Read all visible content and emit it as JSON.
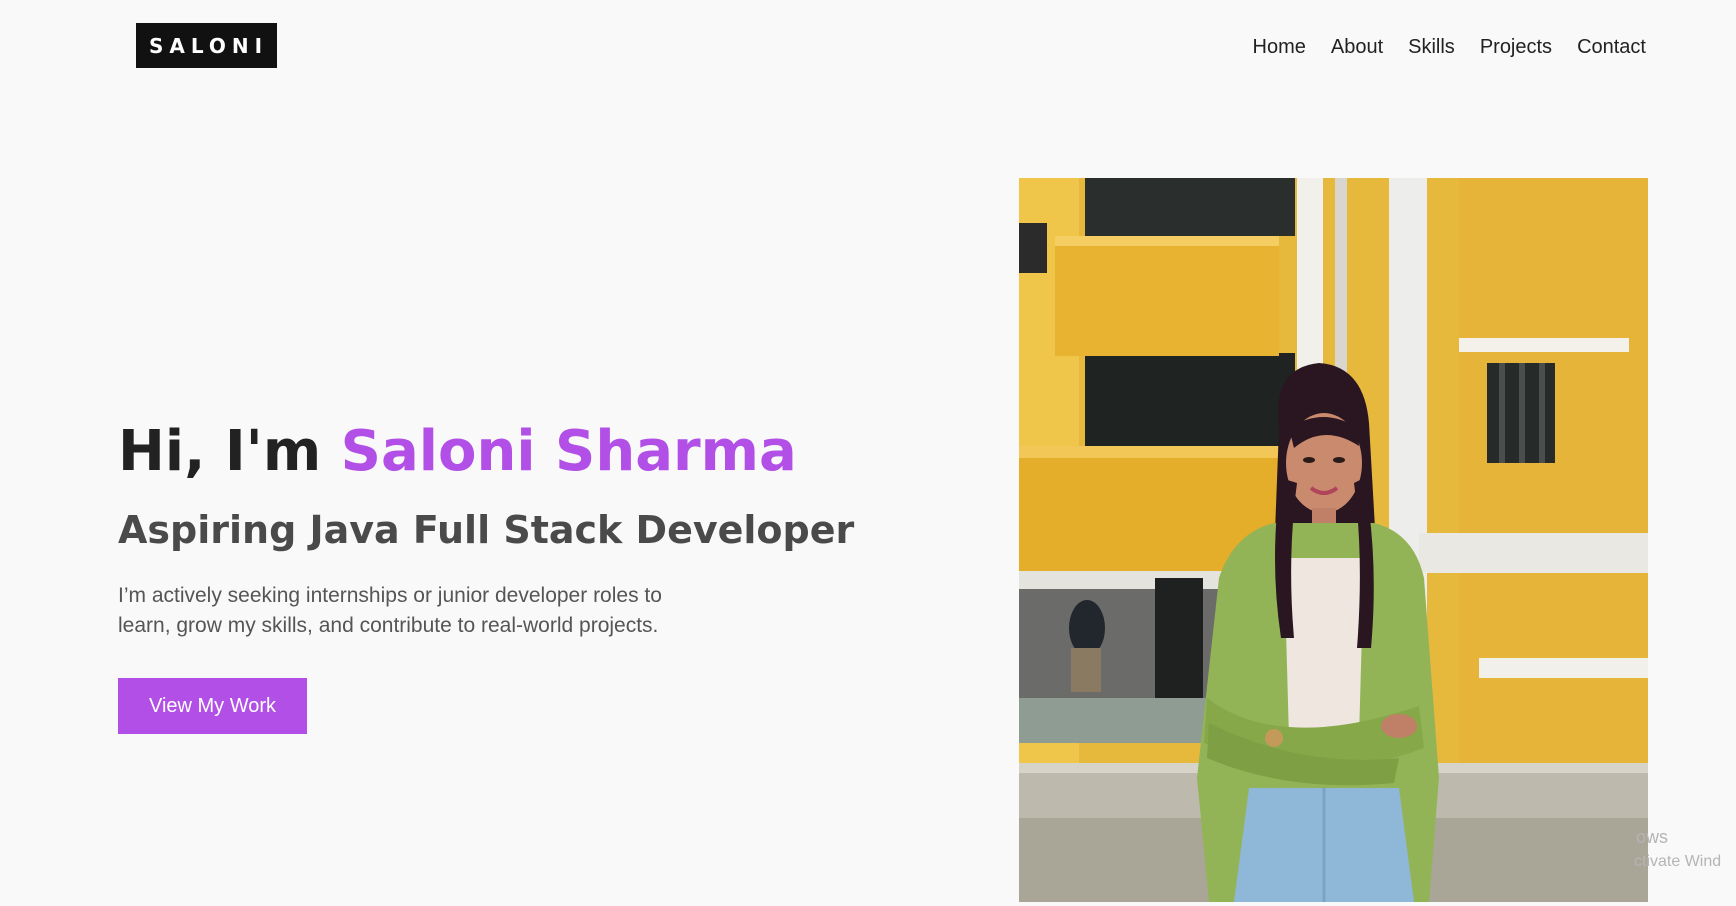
{
  "header": {
    "logo": "SALONI",
    "nav": [
      "Home",
      "About",
      "Skills",
      "Projects",
      "Contact"
    ]
  },
  "hero": {
    "greeting": "Hi, I'm ",
    "name": "Saloni Sharma",
    "subtitle": "Aspiring Java Full Stack Developer",
    "description_line1": "I’m actively seeking internships or junior developer roles to",
    "description_line2": "learn, grow my skills, and contribute to real-world projects.",
    "cta_label": "View My Work"
  },
  "watermark": {
    "line1": "ows",
    "line2": "ctivate Wind"
  },
  "colors": {
    "accent": "#b24fe6",
    "background": "#f9f9f9",
    "logo_bg": "#111111",
    "text_dark": "#222222",
    "text_muted": "#555555"
  }
}
